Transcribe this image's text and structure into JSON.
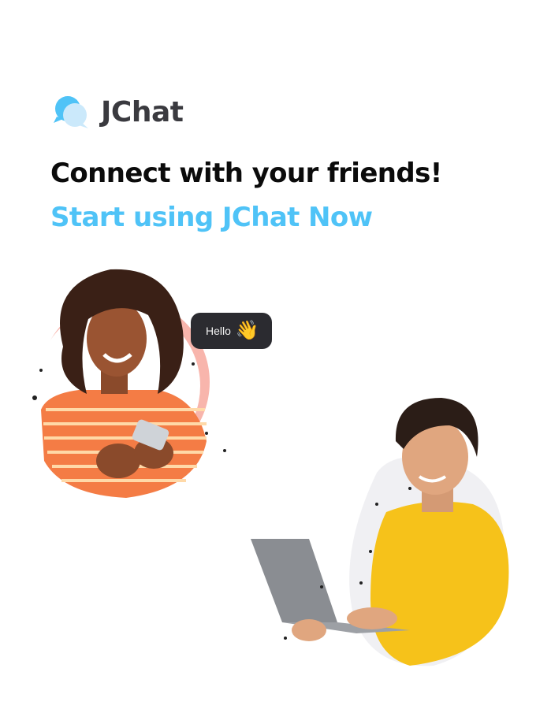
{
  "brand": {
    "name": "JChat",
    "logo_icon": "chat-bubbles-icon",
    "accent_color": "#4fc3f7"
  },
  "hero": {
    "headline": "Connect with your friends!",
    "subline": "Start using JChat Now"
  },
  "illustration": {
    "chat_bubble_text": "Hello",
    "chat_bubble_emoji": "👋",
    "woman_shirt_color": "#f47c45",
    "man_shirt_color": "#f6c21a"
  }
}
